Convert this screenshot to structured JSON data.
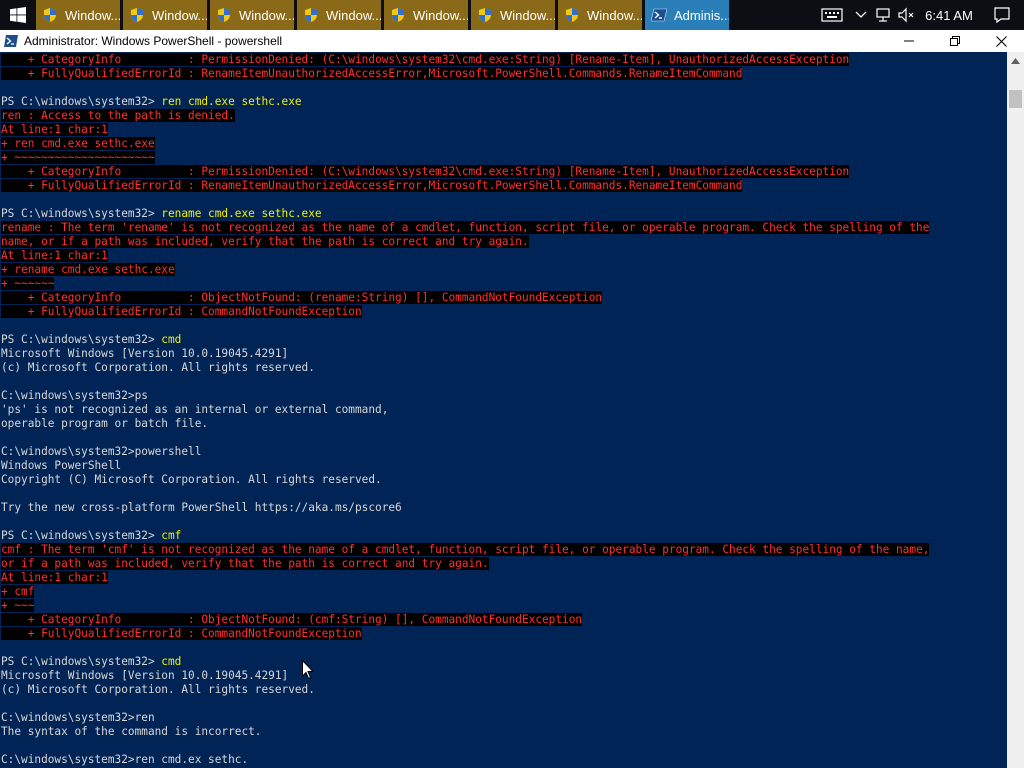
{
  "taskbar": {
    "items": [
      {
        "label": "Window...",
        "icon": "uac-shield-icon",
        "active": false
      },
      {
        "label": "Window...",
        "icon": "uac-shield-icon",
        "active": false
      },
      {
        "label": "Window...",
        "icon": "uac-shield-icon",
        "active": false
      },
      {
        "label": "Window...",
        "icon": "uac-shield-icon",
        "active": false
      },
      {
        "label": "Window...",
        "icon": "uac-shield-icon",
        "active": false
      },
      {
        "label": "Window...",
        "icon": "uac-shield-icon",
        "active": false
      },
      {
        "label": "Window...",
        "icon": "uac-shield-icon",
        "active": false
      },
      {
        "label": "Adminis...",
        "icon": "powershell-icon",
        "active": true
      }
    ],
    "clock": "6:41 AM",
    "colors": {
      "inactive": "#8a6a19",
      "active": "#2a7fb8",
      "bar": "#0b0f14"
    }
  },
  "window": {
    "title": "Administrator: Windows PowerShell - powershell"
  },
  "console": {
    "colors": {
      "bg": "#012456",
      "text": "#d7d7d7",
      "command": "#f0f000",
      "error": "#ff3030",
      "error_bg": "#000000"
    },
    "lines": [
      {
        "t": "err",
        "text": "    + CategoryInfo          : PermissionDenied: (C:\\windows\\system32\\cmd.exe:String) [Rename-Item], UnauthorizedAccessException"
      },
      {
        "t": "err",
        "text": "    + FullyQualifiedErrorId : RenameItemUnauthorizedAccessError,Microsoft.PowerShell.Commands.RenameItemCommand"
      },
      {
        "t": "blank",
        "text": ""
      },
      {
        "t": "prompt",
        "ps": "PS C:\\windows\\system32> ",
        "cmd": "ren cmd.exe sethc.exe"
      },
      {
        "t": "err",
        "text": "ren : Access to the path is denied."
      },
      {
        "t": "err",
        "text": "At line:1 char:1"
      },
      {
        "t": "err",
        "text": "+ ren cmd.exe sethc.exe"
      },
      {
        "t": "err",
        "text": "+ ~~~~~~~~~~~~~~~~~~~~~"
      },
      {
        "t": "err",
        "text": "    + CategoryInfo          : PermissionDenied: (C:\\windows\\system32\\cmd.exe:String) [Rename-Item], UnauthorizedAccessException"
      },
      {
        "t": "err",
        "text": "    + FullyQualifiedErrorId : RenameItemUnauthorizedAccessError,Microsoft.PowerShell.Commands.RenameItemCommand"
      },
      {
        "t": "blank",
        "text": ""
      },
      {
        "t": "prompt",
        "ps": "PS C:\\windows\\system32> ",
        "cmd": "rename cmd.exe sethc.exe"
      },
      {
        "t": "err",
        "text": "rename : The term 'rename' is not recognized as the name of a cmdlet, function, script file, or operable program. Check the spelling of the"
      },
      {
        "t": "err",
        "text": "name, or if a path was included, verify that the path is correct and try again."
      },
      {
        "t": "err",
        "text": "At line:1 char:1"
      },
      {
        "t": "err",
        "text": "+ rename cmd.exe sethc.exe"
      },
      {
        "t": "err",
        "text": "+ ~~~~~~"
      },
      {
        "t": "err",
        "text": "    + CategoryInfo          : ObjectNotFound: (rename:String) [], CommandNotFoundException"
      },
      {
        "t": "err",
        "text": "    + FullyQualifiedErrorId : CommandNotFoundException"
      },
      {
        "t": "blank",
        "text": ""
      },
      {
        "t": "prompt",
        "ps": "PS C:\\windows\\system32> ",
        "cmd": "cmd"
      },
      {
        "t": "plain",
        "text": "Microsoft Windows [Version 10.0.19045.4291]"
      },
      {
        "t": "plain",
        "text": "(c) Microsoft Corporation. All rights reserved."
      },
      {
        "t": "blank",
        "text": ""
      },
      {
        "t": "plain",
        "text": "C:\\windows\\system32>ps"
      },
      {
        "t": "plain",
        "text": "'ps' is not recognized as an internal or external command,"
      },
      {
        "t": "plain",
        "text": "operable program or batch file."
      },
      {
        "t": "blank",
        "text": ""
      },
      {
        "t": "plain",
        "text": "C:\\windows\\system32>powershell"
      },
      {
        "t": "plain",
        "text": "Windows PowerShell"
      },
      {
        "t": "plain",
        "text": "Copyright (C) Microsoft Corporation. All rights reserved."
      },
      {
        "t": "blank",
        "text": ""
      },
      {
        "t": "plain",
        "text": "Try the new cross-platform PowerShell https://aka.ms/pscore6"
      },
      {
        "t": "blank",
        "text": ""
      },
      {
        "t": "prompt",
        "ps": "PS C:\\windows\\system32> ",
        "cmd": "cmf"
      },
      {
        "t": "err",
        "text": "cmf : The term 'cmf' is not recognized as the name of a cmdlet, function, script file, or operable program. Check the spelling of the name,"
      },
      {
        "t": "err",
        "text": "or if a path was included, verify that the path is correct and try again."
      },
      {
        "t": "err",
        "text": "At line:1 char:1"
      },
      {
        "t": "err",
        "text": "+ cmf"
      },
      {
        "t": "err",
        "text": "+ ~~~"
      },
      {
        "t": "err",
        "text": "    + CategoryInfo          : ObjectNotFound: (cmf:String) [], CommandNotFoundException"
      },
      {
        "t": "err",
        "text": "    + FullyQualifiedErrorId : CommandNotFoundException"
      },
      {
        "t": "blank",
        "text": ""
      },
      {
        "t": "prompt",
        "ps": "PS C:\\windows\\system32> ",
        "cmd": "cmd"
      },
      {
        "t": "plain",
        "text": "Microsoft Windows [Version 10.0.19045.4291]"
      },
      {
        "t": "plain",
        "text": "(c) Microsoft Corporation. All rights reserved."
      },
      {
        "t": "blank",
        "text": ""
      },
      {
        "t": "plain",
        "text": "C:\\windows\\system32>ren"
      },
      {
        "t": "plain",
        "text": "The syntax of the command is incorrect."
      },
      {
        "t": "blank",
        "text": ""
      },
      {
        "t": "plain",
        "text": "C:\\windows\\system32>ren cmd.ex sethc."
      }
    ]
  }
}
